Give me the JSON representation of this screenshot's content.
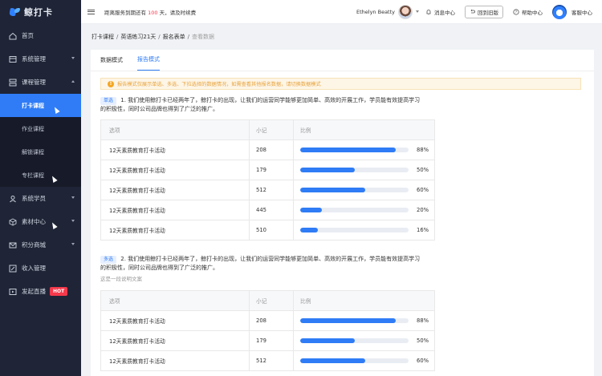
{
  "brand": {
    "name": "鲸打卡"
  },
  "sidebar": {
    "items": [
      {
        "label": "首页",
        "icon": "home-icon"
      },
      {
        "label": "系统管理",
        "icon": "system-icon"
      },
      {
        "label": "课程管理",
        "icon": "course-icon"
      }
    ],
    "subitems": [
      {
        "label": "打卡课程",
        "active": true
      },
      {
        "label": "作业课程"
      },
      {
        "label": "解锁课程"
      },
      {
        "label": "专栏课程"
      }
    ],
    "items2": [
      {
        "label": "系统学员",
        "icon": "users-icon"
      },
      {
        "label": "素材中心",
        "icon": "cube-icon"
      },
      {
        "label": "积分商城",
        "icon": "mail-icon"
      },
      {
        "label": "收入管理",
        "icon": "edit-icon"
      },
      {
        "label": "发起直播",
        "icon": "live-icon",
        "badge": "HOT"
      }
    ]
  },
  "header": {
    "notice_prefix": "距离服务到期还有",
    "notice_days": "100",
    "notice_suffix": "天，请及时续费",
    "user_name": "Ethelyn Beatty",
    "messages": "消息中心",
    "back_old": "回到旧版",
    "help": "帮助中心",
    "service": "客服中心"
  },
  "breadcrumb": {
    "items": [
      "打卡课程",
      "英语练习21天",
      "报名表单"
    ],
    "current": "查看数据",
    "sep": "/"
  },
  "tabs": [
    "数据模式",
    "报告模式"
  ],
  "alert": "报告模式仅展示单选、多选、下拉选择的数据情况，如需查看其他报名数据，请切换数据模式",
  "table_headers": {
    "option": "选项",
    "count": "小记",
    "ratio": "比例"
  },
  "questions": [
    {
      "tag": "单选",
      "title_line1": "1. 我们使用鲸打卡已经两年了，鲸打卡的出现，让我们的运营同学能够更加简单、高效的开展工作，学员能有效提高学习",
      "title_line2": "的积极性，同时公司品牌也得到了广泛的推广。",
      "description": "",
      "rows": [
        {
          "option": "12天素质教育打卡活动",
          "count": "208",
          "ratio": 0.88,
          "ratio_text": "88%"
        },
        {
          "option": "12天素质教育打卡活动",
          "count": "179",
          "ratio": 0.5,
          "ratio_text": "50%"
        },
        {
          "option": "12天素质教育打卡活动",
          "count": "512",
          "ratio": 0.6,
          "ratio_text": "60%"
        },
        {
          "option": "12天素质教育打卡活动",
          "count": "445",
          "ratio": 0.2,
          "ratio_text": "20%"
        },
        {
          "option": "12天素质教育打卡活动",
          "count": "510",
          "ratio": 0.16,
          "ratio_text": "16%"
        }
      ]
    },
    {
      "tag": "多选",
      "title_line1": "2. 我们使用鲸打卡已经两年了，鲸打卡的出现，让我们的运营同学能够更加简单、高效的开展工作，学员能有效提高学习",
      "title_line2": "的积极性，同时公司品牌也得到了广泛的推广。",
      "description": "这是一段说明文案",
      "rows": [
        {
          "option": "12天素质教育打卡活动",
          "count": "208",
          "ratio": 0.88,
          "ratio_text": "88%"
        },
        {
          "option": "12天素质教育打卡活动",
          "count": "179",
          "ratio": 0.5,
          "ratio_text": "50%"
        },
        {
          "option": "12天素质教育打卡活动",
          "count": "512",
          "ratio": 0.6,
          "ratio_text": "60%"
        }
      ]
    }
  ],
  "colors": {
    "accent": "#2f7cf6",
    "sidebar_bg": "#1f2436",
    "hot": "#f5394b",
    "warning": "#f5a623"
  }
}
